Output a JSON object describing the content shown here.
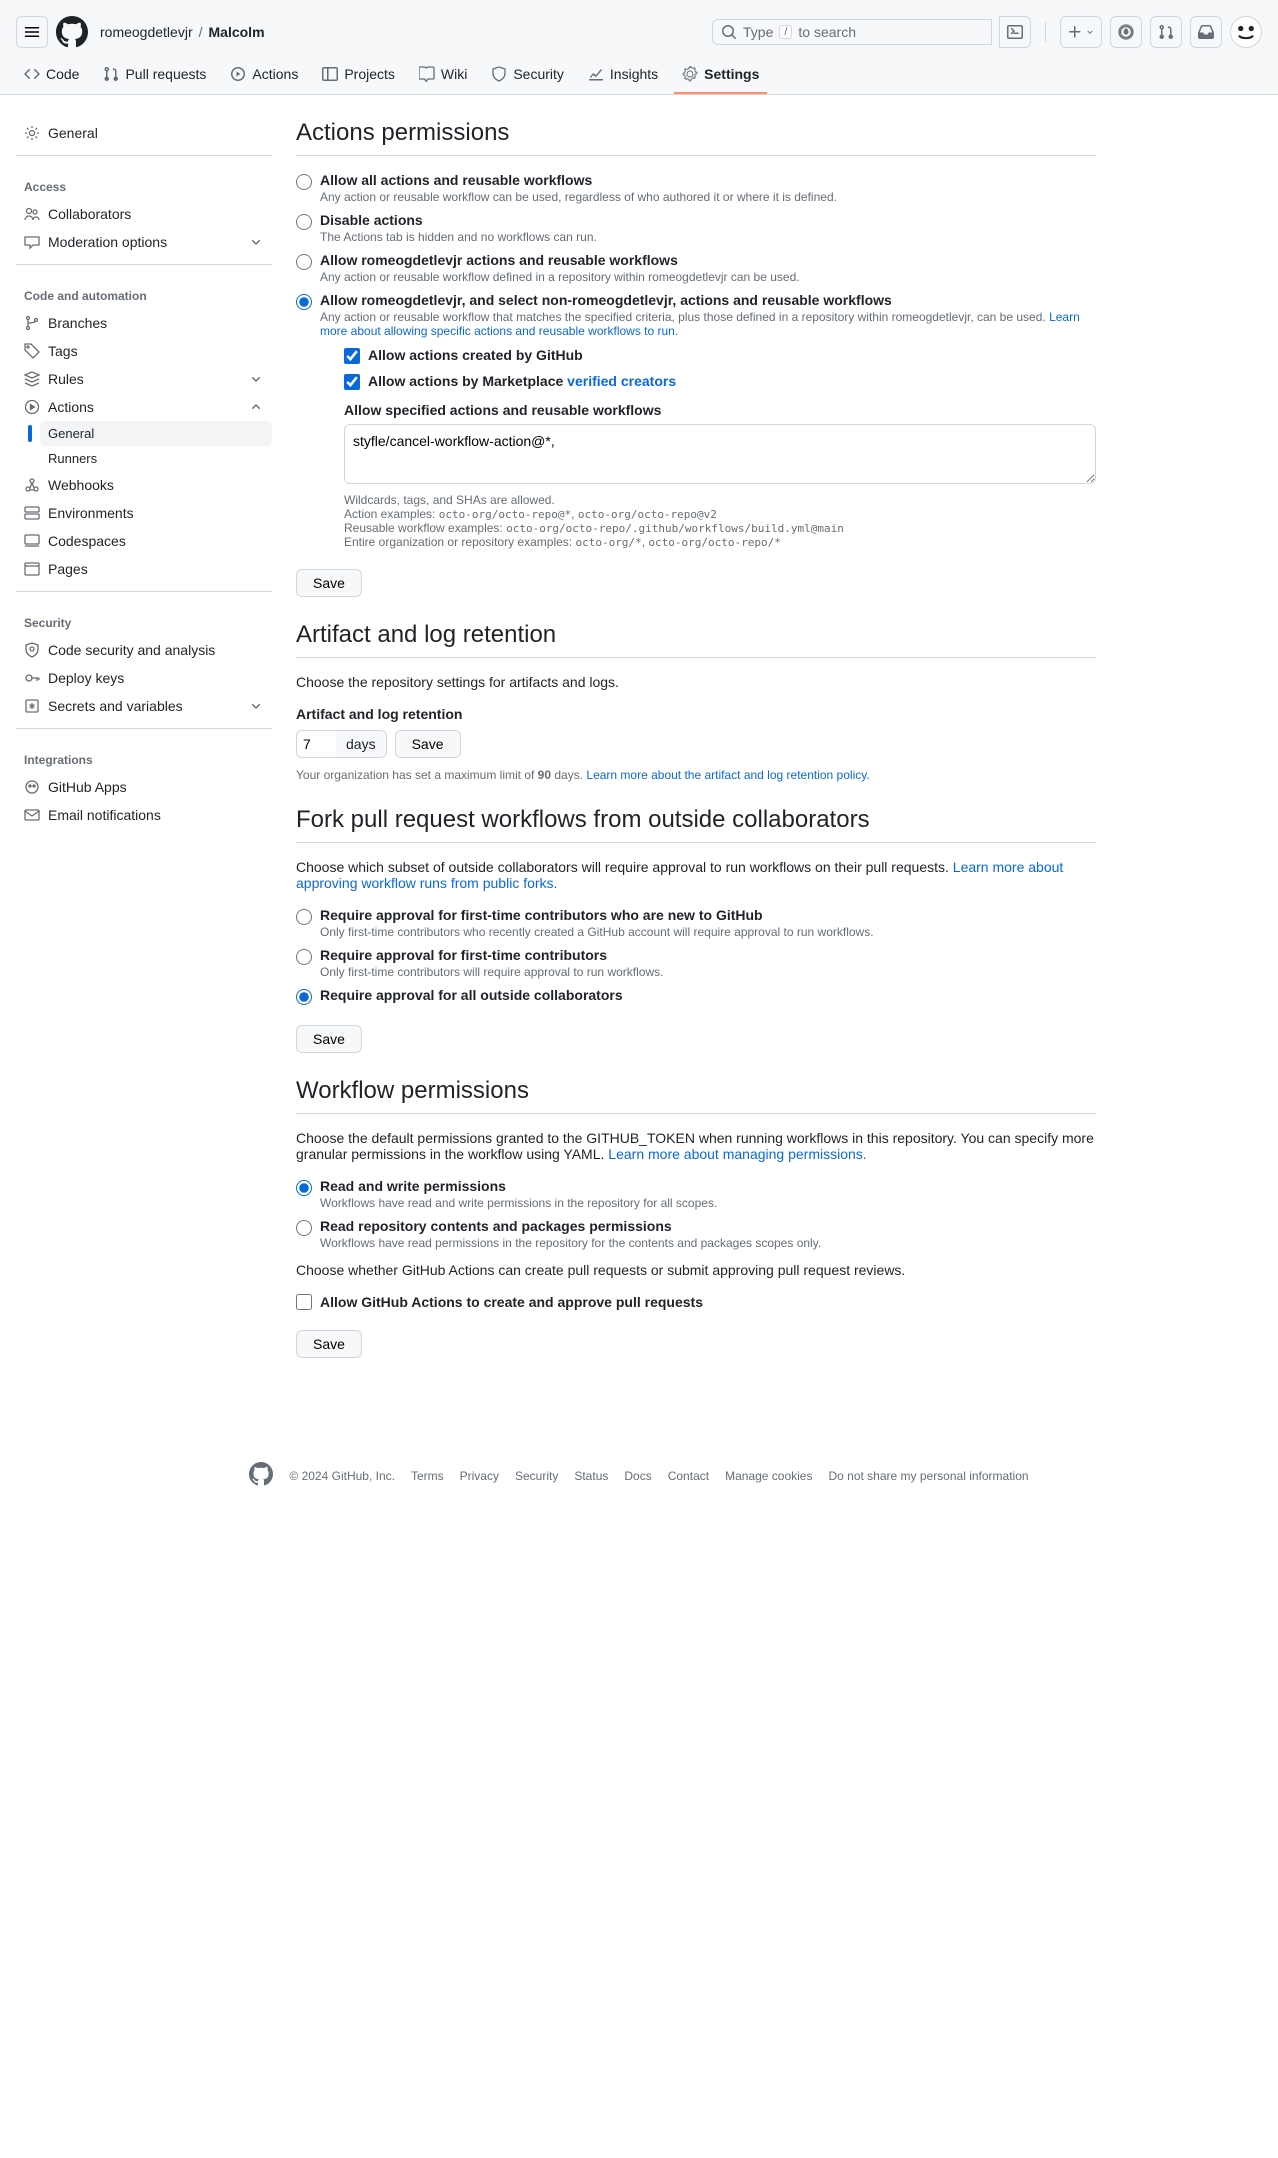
{
  "header": {
    "owner": "romeogdetlevjr",
    "repo": "Malcolm",
    "search_placeholder_prefix": "Type",
    "search_placeholder_suffix": "to search",
    "search_key": "/"
  },
  "repo_nav": {
    "code": "Code",
    "pulls": "Pull requests",
    "actions": "Actions",
    "projects": "Projects",
    "wiki": "Wiki",
    "security": "Security",
    "insights": "Insights",
    "settings": "Settings"
  },
  "sidebar": {
    "general": "General",
    "access_label": "Access",
    "collaborators": "Collaborators",
    "moderation": "Moderation options",
    "code_label": "Code and automation",
    "branches": "Branches",
    "tags": "Tags",
    "rules": "Rules",
    "actions": "Actions",
    "actions_general": "General",
    "actions_runners": "Runners",
    "webhooks": "Webhooks",
    "environments": "Environments",
    "codespaces": "Codespaces",
    "pages": "Pages",
    "security_label": "Security",
    "code_security": "Code security and analysis",
    "deploy_keys": "Deploy keys",
    "secrets": "Secrets and variables",
    "integrations_label": "Integrations",
    "github_apps": "GitHub Apps",
    "email_notif": "Email notifications"
  },
  "actions_permissions": {
    "title": "Actions permissions",
    "opt1_label": "Allow all actions and reusable workflows",
    "opt1_desc": "Any action or reusable workflow can be used, regardless of who authored it or where it is defined.",
    "opt2_label": "Disable actions",
    "opt2_desc": "The Actions tab is hidden and no workflows can run.",
    "opt3_label": "Allow romeogdetlevjr actions and reusable workflows",
    "opt3_desc": "Any action or reusable workflow defined in a repository within romeogdetlevjr can be used.",
    "opt4_label": "Allow romeogdetlevjr, and select non-romeogdetlevjr, actions and reusable workflows",
    "opt4_desc_prefix": "Any action or reusable workflow that matches the specified criteria, plus those defined in a repository within romeogdetlevjr, can be used. ",
    "opt4_link": "Learn more about allowing specific actions and reusable workflows to run.",
    "allow_github": "Allow actions created by GitHub",
    "allow_marketplace_prefix": "Allow actions by Marketplace ",
    "allow_marketplace_link": "verified creators",
    "specified_label": "Allow specified actions and reusable workflows",
    "specified_value": "styfle/cancel-workflow-action@*,",
    "hints": {
      "wildcards": "Wildcards, tags, and SHAs are allowed.",
      "action_prefix": "Action examples: ",
      "action_code1": "octo-org/octo-repo@*",
      "action_code2": "octo-org/octo-repo@v2",
      "workflow_prefix": "Reusable workflow examples: ",
      "workflow_code": "octo-org/octo-repo/.github/workflows/build.yml@main",
      "org_prefix": "Entire organization or repository examples: ",
      "org_code1": "octo-org/*",
      "org_code2": "octo-org/octo-repo/*"
    },
    "save": "Save"
  },
  "retention": {
    "title": "Artifact and log retention",
    "desc": "Choose the repository settings for artifacts and logs.",
    "field_label": "Artifact and log retention",
    "value": "7",
    "unit": "days",
    "save": "Save",
    "hint_prefix": "Your organization has set a maximum limit of ",
    "hint_bold": "90",
    "hint_suffix": " days. ",
    "hint_link": "Learn more about the artifact and log retention policy."
  },
  "fork": {
    "title": "Fork pull request workflows from outside collaborators",
    "desc_prefix": "Choose which subset of outside collaborators will require approval to run workflows on their pull requests. ",
    "desc_link": "Learn more about approving workflow runs from public forks.",
    "opt1_label": "Require approval for first-time contributors who are new to GitHub",
    "opt1_desc": "Only first-time contributors who recently created a GitHub account will require approval to run workflows.",
    "opt2_label": "Require approval for first-time contributors",
    "opt2_desc": "Only first-time contributors will require approval to run workflows.",
    "opt3_label": "Require approval for all outside collaborators",
    "save": "Save"
  },
  "workflow_perms": {
    "title": "Workflow permissions",
    "desc_prefix": "Choose the default permissions granted to the GITHUB_TOKEN when running workflows in this repository. You can specify more granular permissions in the workflow using YAML. ",
    "desc_link": "Learn more about managing permissions.",
    "opt1_label": "Read and write permissions",
    "opt1_desc": "Workflows have read and write permissions in the repository for all scopes.",
    "opt2_label": "Read repository contents and packages permissions",
    "opt2_desc": "Workflows have read permissions in the repository for the contents and packages scopes only.",
    "pr_desc": "Choose whether GitHub Actions can create pull requests or submit approving pull request reviews.",
    "pr_check": "Allow GitHub Actions to create and approve pull requests",
    "save": "Save"
  },
  "footer": {
    "copyright": "© 2024 GitHub, Inc.",
    "terms": "Terms",
    "privacy": "Privacy",
    "security": "Security",
    "status": "Status",
    "docs": "Docs",
    "contact": "Contact",
    "cookies": "Manage cookies",
    "dont_share": "Do not share my personal information"
  }
}
